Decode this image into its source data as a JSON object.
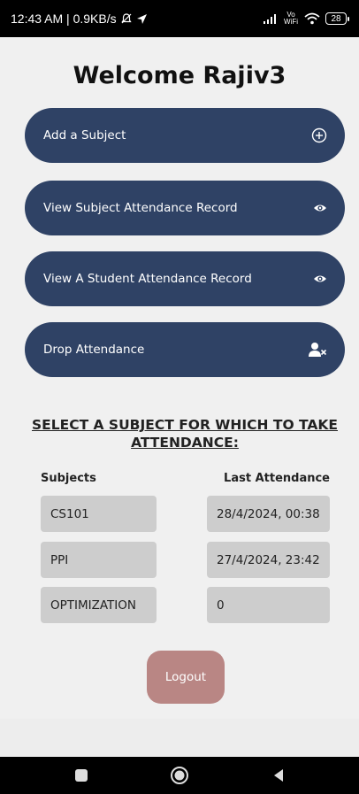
{
  "status_bar": {
    "time_and_speed": "12:43 AM | 0.9KB/s",
    "vo_wifi": "Vo WiFi",
    "battery_level": "28"
  },
  "welcome_title": "Welcome Rajiv3",
  "actions": [
    {
      "label": "Add a Subject",
      "icon": "plus-circle-icon"
    },
    {
      "label": "View Subject Attendance Record",
      "icon": "eye-icon"
    },
    {
      "label": "View A Student Attendance Record",
      "icon": "eye-icon"
    },
    {
      "label": "Drop Attendance",
      "icon": "remove-user-icon"
    }
  ],
  "select_heading": "SELECT A SUBJECT FOR WHICH TO TAKE ATTENDANCE:",
  "table": {
    "headers": [
      "Subjects",
      "Last Attendance"
    ],
    "rows": [
      {
        "subject": "CS101",
        "last_attendance": "28/4/2024, 00:38"
      },
      {
        "subject": "PPI",
        "last_attendance": "27/4/2024, 23:42"
      },
      {
        "subject": "OPTIMIZATION",
        "last_attendance": "0"
      }
    ]
  },
  "logout_label": "Logout",
  "colors": {
    "button_primary": "#2f4265",
    "logout": "#b98684",
    "cell_bg": "#cdcdcd",
    "background": "#f0f0f0"
  }
}
